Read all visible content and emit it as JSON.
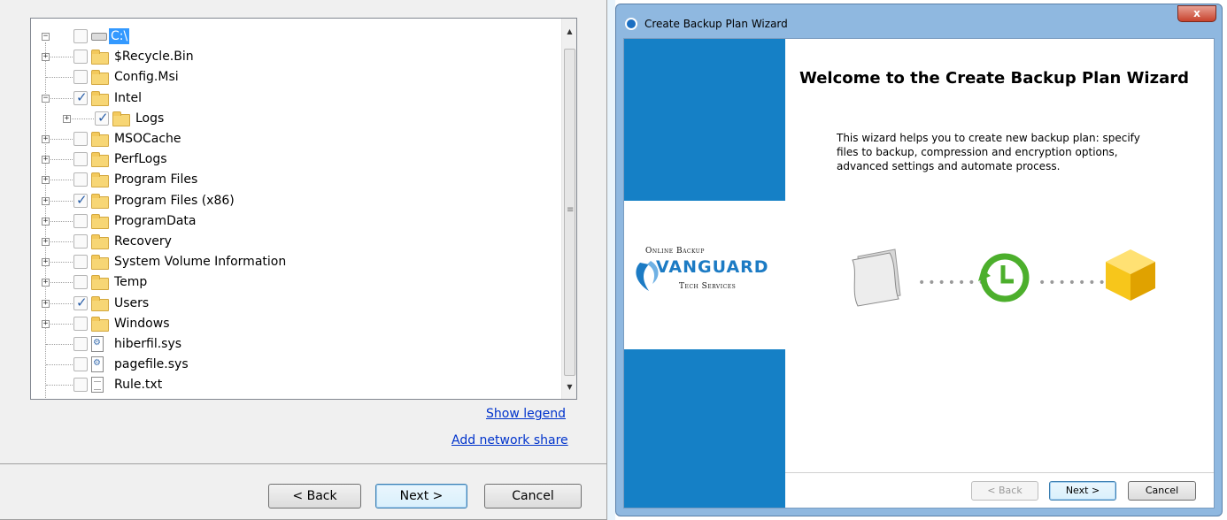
{
  "left_window": {
    "tree": {
      "root": {
        "label": "C:\\",
        "expander": "−"
      },
      "items": [
        {
          "label": "$Recycle.Bin",
          "expander": "+",
          "checked": false,
          "icon": "folder-icon"
        },
        {
          "label": "Config.Msi",
          "expander": "",
          "checked": false,
          "icon": "folder-icon"
        },
        {
          "label": "Intel",
          "expander": "−",
          "checked": true,
          "icon": "folder-icon"
        },
        {
          "label": "Logs",
          "expander": "+",
          "checked": true,
          "icon": "folder-icon"
        },
        {
          "label": "MSOCache",
          "expander": "+",
          "checked": false,
          "icon": "folder-icon"
        },
        {
          "label": "PerfLogs",
          "expander": "+",
          "checked": false,
          "icon": "folder-icon"
        },
        {
          "label": "Program Files",
          "expander": "+",
          "checked": false,
          "icon": "folder-icon"
        },
        {
          "label": "Program Files (x86)",
          "expander": "+",
          "checked": true,
          "icon": "folder-icon"
        },
        {
          "label": "ProgramData",
          "expander": "+",
          "checked": false,
          "icon": "folder-icon"
        },
        {
          "label": "Recovery",
          "expander": "+",
          "checked": false,
          "icon": "folder-icon"
        },
        {
          "label": "System Volume Information",
          "expander": "+",
          "checked": false,
          "icon": "folder-icon"
        },
        {
          "label": "Temp",
          "expander": "+",
          "checked": false,
          "icon": "folder-icon"
        },
        {
          "label": "Users",
          "expander": "+",
          "checked": true,
          "icon": "folder-icon"
        },
        {
          "label": "Windows",
          "expander": "+",
          "checked": false,
          "icon": "folder-icon"
        },
        {
          "label": "hiberfil.sys",
          "expander": "",
          "checked": false,
          "icon": "system-file-icon"
        },
        {
          "label": "pagefile.sys",
          "expander": "",
          "checked": false,
          "icon": "system-file-icon"
        },
        {
          "label": "Rule.txt",
          "expander": "",
          "checked": false,
          "icon": "text-file-icon"
        }
      ]
    },
    "links": {
      "show_legend": "Show legend",
      "add_network_share": "Add network share"
    },
    "buttons": {
      "back": "< Back",
      "next": "Next >",
      "cancel": "Cancel"
    }
  },
  "wizard": {
    "title": "Create Backup Plan Wizard",
    "close_glyph": "x",
    "heading": "Welcome to the Create Backup Plan Wizard",
    "description": "This wizard helps you to create new backup plan: specify files to backup, compression and encryption options, advanced settings and automate process.",
    "logo": {
      "line1": "Online Backup",
      "line2": "VANGUARD",
      "line3": "Tech Services"
    },
    "buttons": {
      "back": "< Back",
      "next": "Next >",
      "cancel": "Cancel"
    },
    "colors": {
      "side_strip": "#1580c6",
      "title_bar": "#8fb8e0",
      "logo_blue": "#1c7bc4"
    }
  }
}
